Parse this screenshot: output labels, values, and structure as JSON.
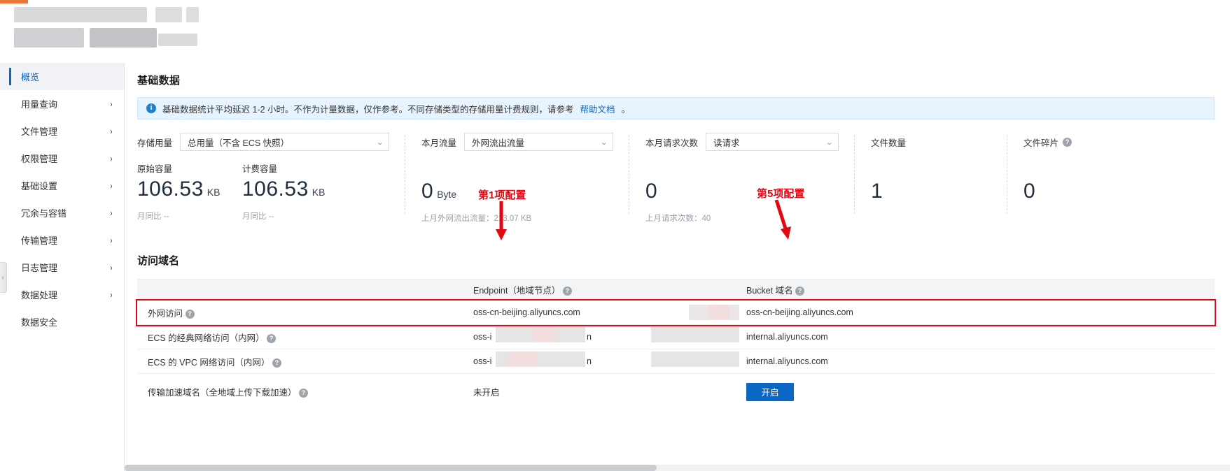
{
  "sidebar": {
    "items": [
      {
        "label": "概览",
        "active": true,
        "chevron": ""
      },
      {
        "label": "用量查询",
        "active": false,
        "chevron": "›"
      },
      {
        "label": "文件管理",
        "active": false,
        "chevron": "›"
      },
      {
        "label": "权限管理",
        "active": false,
        "chevron": "›"
      },
      {
        "label": "基础设置",
        "active": false,
        "chevron": "›"
      },
      {
        "label": "冗余与容错",
        "active": false,
        "chevron": "›"
      },
      {
        "label": "传输管理",
        "active": false,
        "chevron": "›"
      },
      {
        "label": "日志管理",
        "active": false,
        "chevron": "›"
      },
      {
        "label": "数据处理",
        "active": false,
        "chevron": "›"
      },
      {
        "label": "数据安全",
        "active": false,
        "chevron": ""
      }
    ],
    "collapse_glyph": "›"
  },
  "basic_data": {
    "title": "基础数据",
    "notice": {
      "icon": "i",
      "text": "基础数据统计平均延迟 1-2 小时。不作为计量数据，仅作参考。不同存储类型的存储用量计费规则，请参考",
      "link": "帮助文档",
      "tail": "。"
    },
    "storage": {
      "label": "存储用量",
      "selected": "总用量（不含 ECS 快照）",
      "caret": "⌄",
      "metrics": [
        {
          "caption": "原始容量",
          "value": "106.53",
          "unit": "KB",
          "foot": "月同比  --"
        },
        {
          "caption": "计费容量",
          "value": "106.53",
          "unit": "KB",
          "foot": "月同比  --"
        }
      ]
    },
    "traffic": {
      "label": "本月流量",
      "selected": "外网流出流量",
      "caret": "⌄",
      "value": "0",
      "unit": "Byte",
      "foot": "上月外网流出流量：213.07 KB"
    },
    "requests": {
      "label": "本月请求次数",
      "selected": "读请求",
      "caret": "⌄",
      "value": "0",
      "unit": "",
      "foot": "上月请求次数：40"
    },
    "file_count": {
      "label": "文件数量",
      "value": "1"
    },
    "file_fragment": {
      "label": "文件碎片",
      "value": "0",
      "help": "?"
    }
  },
  "access_domain": {
    "title": "访问域名",
    "headers": {
      "blank": "",
      "endpoint": "Endpoint（地域节点）",
      "endpoint_help": "?",
      "bucket": "Bucket 域名",
      "bucket_help": "?"
    },
    "rows": [
      {
        "name": "外网访问",
        "help": "?",
        "endpoint": "oss-cn-beijing.aliyuncs.com",
        "bucket": "oss-cn-beijing.aliyuncs.com",
        "highlight": true
      },
      {
        "name": "ECS 的经典网络访问（内网）",
        "help": "?",
        "endpoint": "oss-i",
        "endpoint_tail": "n",
        "bucket": "internal.aliyuncs.com",
        "highlight": false
      },
      {
        "name": "ECS 的 VPC 网络访问（内网）",
        "help": "?",
        "endpoint": "oss-i",
        "endpoint_tail": "n",
        "bucket": "internal.aliyuncs.com",
        "highlight": false
      }
    ],
    "accel_row": {
      "name": "传输加速域名（全地域上传下载加速）",
      "help": "?",
      "status": "未开启",
      "button": "开启"
    }
  },
  "annotations": [
    {
      "text": "第1项配置",
      "color": "#e30613"
    },
    {
      "text": "第5项配置",
      "color": "#e30613"
    }
  ],
  "colors": {
    "accent": "#0a67c4",
    "annotation": "#e30613",
    "notice_bg": "#e8f4fd",
    "header_bg": "#f3f4f6"
  }
}
